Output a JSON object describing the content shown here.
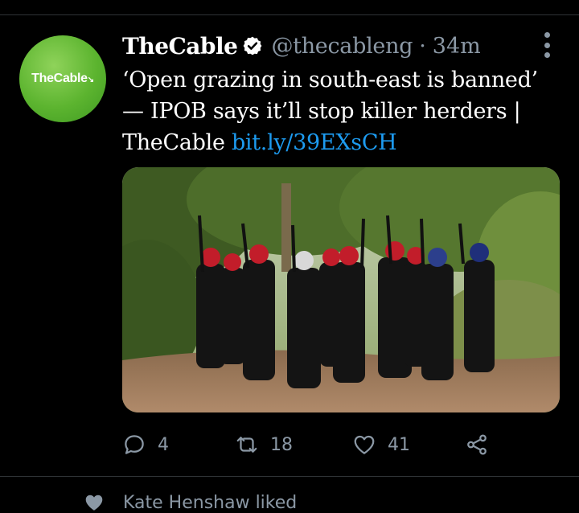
{
  "tweet": {
    "avatar_text": "TheCable",
    "display_name": "TheCable",
    "handle": "@thecableng",
    "separator": "·",
    "time": "34m",
    "text_main": "‘Open grazing in south-east is banned’ — IPOB says it’ll stop killer herders | TheCable",
    "link_text": "bit.ly/39EXsCH",
    "media_alt": "",
    "actions": {
      "reply_count": "4",
      "retweet_count": "18",
      "like_count": "41"
    }
  },
  "next_item": {
    "text": "Kate Henshaw liked"
  },
  "colors": {
    "background": "#000000",
    "secondary_text": "#8b98a5",
    "link": "#1d9bf0",
    "avatar_green": "#5cb42f",
    "divider": "#2f3336"
  }
}
